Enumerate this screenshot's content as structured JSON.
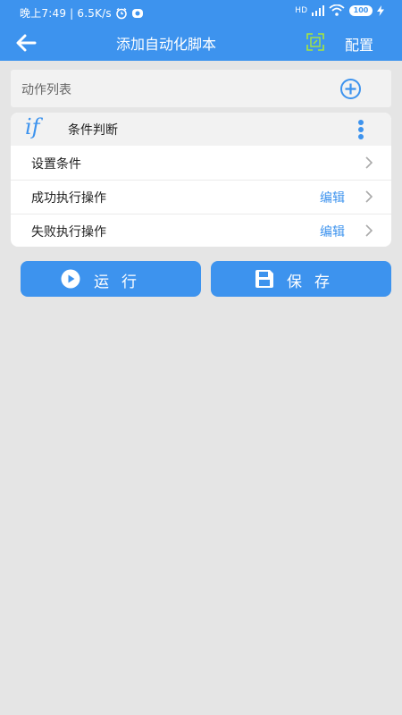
{
  "status_bar": {
    "time_speed": "晚上7:49 | 6.5K/s",
    "hd_label": "HD",
    "battery": "100"
  },
  "app_bar": {
    "title": "添加自动化脚本",
    "config_label": "配置"
  },
  "action_list": {
    "header_label": "动作列表"
  },
  "condition_card": {
    "icon_text": "if",
    "title": "条件判断",
    "rows": [
      {
        "label": "设置条件",
        "action": ""
      },
      {
        "label": "成功执行操作",
        "action": "编辑"
      },
      {
        "label": "失败执行操作",
        "action": "编辑"
      }
    ]
  },
  "buttons": {
    "run_label": "运行",
    "save_label": "保存"
  },
  "colors": {
    "accent": "#3d93ee",
    "background": "#e5e5e5",
    "expand_icon": "#a8e63a"
  }
}
